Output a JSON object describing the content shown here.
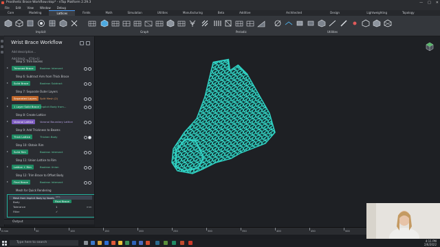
{
  "window": {
    "title": "Prosthetic Brace Workflow.ntop* - nTop Platform 2.29.3",
    "controls": [
      "—",
      "□",
      "✕"
    ]
  },
  "menu": [
    "File",
    "Edit",
    "View",
    "Window",
    "Debug"
  ],
  "tabs": [
    "Core",
    "Modeling",
    "Lattices",
    "Fields",
    "Math",
    "Simulation",
    "Utilities",
    "Manufacturing",
    "Beta",
    "Additive Manufacturing",
    "Architected Materials",
    "Design Analysis",
    "Lightweighting",
    "Topology Optimization"
  ],
  "active_tab": "Lattices",
  "ribbon_groups": [
    "Implicit",
    "Graph",
    "Periodic",
    "Utilities"
  ],
  "panel": {
    "title": "Wrist Brace Workflow",
    "description_placeholder": "Add description...",
    "add_block_placeholder": "Add block... (Ctrl+L)",
    "steps": [
      {
        "caption": "Step 5: Trim Excess",
        "badge": "Trimmed Brace",
        "type": "Boolean Intersect",
        "color": "green",
        "visible": false
      },
      {
        "caption": "Step 6: Subtract Arm from Thick Brace",
        "badge": "Solid Brace",
        "type": "Boolean Subtract",
        "color": "green",
        "visible": false
      },
      {
        "caption": "Step 7: Separate Outer Layers",
        "badge": "Separated Layers",
        "type": "Split Mesh (2)",
        "color": "orange",
        "visible": false
      },
      {
        "caption": "",
        "badge": "1 Layer Solid Brace",
        "type": "Implicit Body from...",
        "color": "green",
        "visible": false
      },
      {
        "caption": "Step 8: Create Lattice",
        "badge": "Voronoi Lattice",
        "type": "Voronoi Boundary Lattice",
        "color": "purple",
        "visible": false
      },
      {
        "caption": "Step 9: Add Thickness to Beams",
        "badge": "Thick Lattice",
        "type": "Thicken Body",
        "color": "green",
        "visible": true
      },
      {
        "caption": "Step 10: Obtain Rim",
        "badge": "Solid Rim",
        "type": "Boolean Intersect",
        "color": "green",
        "visible": false
      },
      {
        "caption": "Step 11: Union Lattice to Rim",
        "badge": "Lattice + Rim",
        "type": "Boolean Union",
        "color": "green",
        "visible": false
      },
      {
        "caption": "Step 12: Trim Brace to Offset Body",
        "badge": "Final Brace",
        "type": "Boolean Intersect",
        "color": "green",
        "visible": false
      }
    ],
    "mesh_caption": "Mesh for Quick Rendering",
    "mesh_block": {
      "title": "Mesh from Implicit Body by Voxels",
      "beta": "BETA",
      "fields": [
        {
          "label": "Body",
          "value": "Final Brace"
        },
        {
          "label": "Tolerance",
          "value": "1"
        },
        {
          "label": "Filter",
          "value": "✓"
        }
      ],
      "unit": "mm"
    }
  },
  "output_label": "Output",
  "ruler": {
    "unit": "mm",
    "labels": [
      "0 mm",
      "50",
      "100",
      "150",
      "200",
      "250",
      "300",
      "350",
      "400",
      "450",
      "500",
      "550",
      "600"
    ]
  },
  "taskbar": {
    "search_placeholder": "Type here to search",
    "time": "4:11 PM",
    "date": "2/6/2022"
  },
  "colors": {
    "lattice": "#2fd0c2",
    "accent": "#1f8a63",
    "selection": "#23b3a0"
  }
}
